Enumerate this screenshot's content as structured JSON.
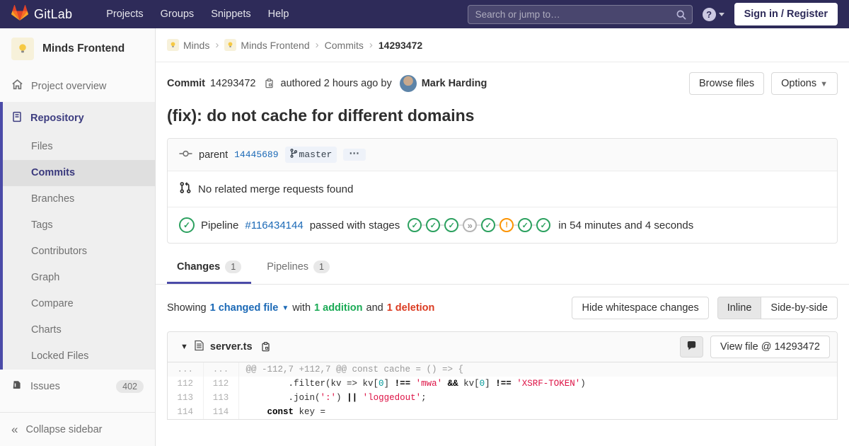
{
  "navbar": {
    "logo_text": "GitLab",
    "menu": [
      "Projects",
      "Groups",
      "Snippets",
      "Help"
    ],
    "search_placeholder": "Search or jump to…",
    "sign_in": "Sign in / Register"
  },
  "sidebar": {
    "project_name": "Minds Frontend",
    "project_overview": "Project overview",
    "repository": "Repository",
    "repo_items": [
      "Files",
      "Commits",
      "Branches",
      "Tags",
      "Contributors",
      "Graph",
      "Compare",
      "Charts",
      "Locked Files"
    ],
    "active_repo_item": "Commits",
    "issues_label": "Issues",
    "issues_count": "402",
    "collapse_label": "Collapse sidebar"
  },
  "breadcrumb": {
    "items": [
      "Minds",
      "Minds Frontend",
      "Commits",
      "14293472"
    ]
  },
  "commit": {
    "label": "Commit",
    "sha": "14293472",
    "authored_text": "authored 2 hours ago by",
    "author": "Mark Harding",
    "browse_files": "Browse files",
    "options": "Options",
    "title": "(fix): do not cache for different domains",
    "parent_label": "parent",
    "parent_sha": "14445689",
    "branch": "master",
    "more_label": "⋯",
    "no_mr_text": "No related merge requests found",
    "pipeline": {
      "label": "Pipeline",
      "id": "#116434144",
      "status_text": "passed with stages",
      "stages": [
        "check",
        "check",
        "check",
        "skipped",
        "check",
        "warning",
        "check",
        "check"
      ],
      "duration": "in 54 minutes and 4 seconds"
    }
  },
  "tabs": [
    {
      "label": "Changes",
      "count": "1"
    },
    {
      "label": "Pipelines",
      "count": "1"
    }
  ],
  "changes_bar": {
    "showing": "Showing",
    "changed_file": "1 changed file",
    "with": "with",
    "addition": "1 addition",
    "and": "and",
    "deletion": "1 deletion",
    "hide_whitespace": "Hide whitespace changes",
    "inline": "Inline",
    "side_by_side": "Side-by-side"
  },
  "diff": {
    "file_name": "server.ts",
    "view_file": "View file @ 14293472",
    "lines": [
      {
        "old": "...",
        "new": "...",
        "type": "hunk",
        "segments": [
          {
            "t": "@@ -112,7 +112,7 @@ const cache = () => {",
            "c": "hunk"
          }
        ]
      },
      {
        "old": "112",
        "new": "112",
        "type": "code",
        "segments": [
          {
            "t": "        .filter(kv => kv[",
            "c": "p"
          },
          {
            "t": "0",
            "c": "num"
          },
          {
            "t": "] ",
            "c": "p"
          },
          {
            "t": "!==",
            "c": "op"
          },
          {
            "t": " ",
            "c": "p"
          },
          {
            "t": "'mwa'",
            "c": "str"
          },
          {
            "t": " ",
            "c": "p"
          },
          {
            "t": "&&",
            "c": "op"
          },
          {
            "t": " kv[",
            "c": "p"
          },
          {
            "t": "0",
            "c": "num"
          },
          {
            "t": "] ",
            "c": "p"
          },
          {
            "t": "!==",
            "c": "op"
          },
          {
            "t": " ",
            "c": "p"
          },
          {
            "t": "'XSRF-TOKEN'",
            "c": "str"
          },
          {
            "t": ")",
            "c": "p"
          }
        ]
      },
      {
        "old": "113",
        "new": "113",
        "type": "code",
        "segments": [
          {
            "t": "        .join(",
            "c": "p"
          },
          {
            "t": "':'",
            "c": "str"
          },
          {
            "t": ") ",
            "c": "p"
          },
          {
            "t": "||",
            "c": "op"
          },
          {
            "t": " ",
            "c": "p"
          },
          {
            "t": "'loggedout'",
            "c": "str"
          },
          {
            "t": ";",
            "c": "p"
          }
        ]
      },
      {
        "old": "114",
        "new": "114",
        "type": "code",
        "segments": [
          {
            "t": "    ",
            "c": "p"
          },
          {
            "t": "const",
            "c": "kw"
          },
          {
            "t": " key =",
            "c": "p"
          }
        ]
      }
    ]
  }
}
